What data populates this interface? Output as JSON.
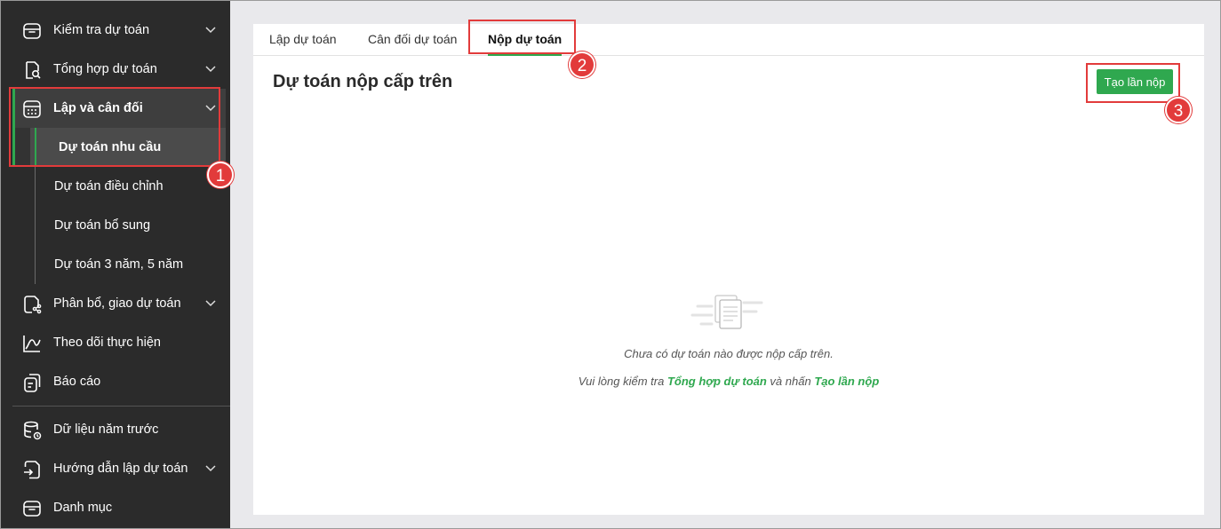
{
  "sidebar": {
    "items": [
      {
        "label": "Kiểm tra dự toán",
        "icon": "box-icon",
        "expandable": true
      },
      {
        "label": "Tổng hợp dự toán",
        "icon": "doc-search-icon",
        "expandable": true
      },
      {
        "label": "Lập và cân đối",
        "icon": "calendar-calc-icon",
        "expandable": true,
        "expanded": true
      },
      {
        "label": "Phân bổ, giao dự toán",
        "icon": "share-doc-icon",
        "expandable": true
      },
      {
        "label": "Theo dõi thực hiện",
        "icon": "line-chart-icon",
        "expandable": false
      },
      {
        "label": "Báo cáo",
        "icon": "report-icon",
        "expandable": false
      },
      {
        "label": "Dữ liệu năm trước",
        "icon": "database-icon",
        "expandable": false
      },
      {
        "label": "Hướng dẫn lập dự toán",
        "icon": "guide-icon",
        "expandable": true
      },
      {
        "label": "Danh mục",
        "icon": "box-icon",
        "expandable": false
      }
    ],
    "subitems": [
      {
        "label": "Dự toán nhu cầu",
        "active": true
      },
      {
        "label": "Dự toán điều chỉnh"
      },
      {
        "label": "Dự toán bổ sung"
      },
      {
        "label": "Dự toán 3 năm, 5 năm"
      }
    ]
  },
  "tabs": [
    {
      "label": "Lập dự toán"
    },
    {
      "label": "Cân đối dự toán"
    },
    {
      "label": "Nộp dự toán",
      "active": true
    }
  ],
  "main": {
    "title": "Dự toán nộp cấp trên",
    "create_button": "Tạo lần nộp",
    "empty_message": "Chưa có dự toán nào được nộp cấp trên.",
    "hint_prefix": "Vui lòng kiểm tra ",
    "hint_link1": "Tổng hợp dự toán",
    "hint_middle": " và nhấn ",
    "hint_link2": "Tạo lần nộp"
  },
  "annotations": {
    "badge1": "1",
    "badge2": "2",
    "badge3": "3"
  },
  "colors": {
    "accent": "#2fa84f",
    "sidebar_bg": "#2b2b2b",
    "annotation": "#e23b3b"
  }
}
